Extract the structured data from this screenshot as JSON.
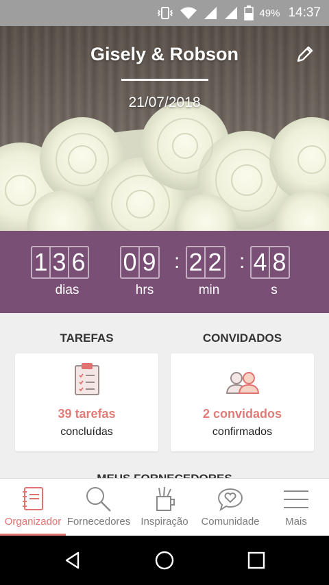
{
  "status_bar": {
    "battery": "49%",
    "time": "14:37"
  },
  "hero": {
    "couple": "Gisely & Robson",
    "date": "21/07/2018"
  },
  "countdown": {
    "days": [
      "1",
      "3",
      "6"
    ],
    "hours": [
      "0",
      "9"
    ],
    "minutes": [
      "2",
      "2"
    ],
    "seconds": [
      "4",
      "8"
    ],
    "labels": {
      "days": "dias",
      "hours": "hrs",
      "minutes": "min",
      "seconds": "s"
    }
  },
  "tasks": {
    "title": "TAREFAS",
    "count": "39 tarefas",
    "caption": "concluídas"
  },
  "guests": {
    "title": "CONVIDADOS",
    "count": "2 convidados",
    "caption": "confirmados"
  },
  "vendors_peek": "MEUS FORNECEDORES",
  "tabs": [
    {
      "label": "Organizador",
      "active": true
    },
    {
      "label": "Fornecedores"
    },
    {
      "label": "Inspiração"
    },
    {
      "label": "Comunidade"
    },
    {
      "label": "Mais"
    }
  ],
  "colors": {
    "accent": "#e0726f",
    "countdown_bg": "#7a4f76",
    "status_bar": "#9e9e9e"
  }
}
